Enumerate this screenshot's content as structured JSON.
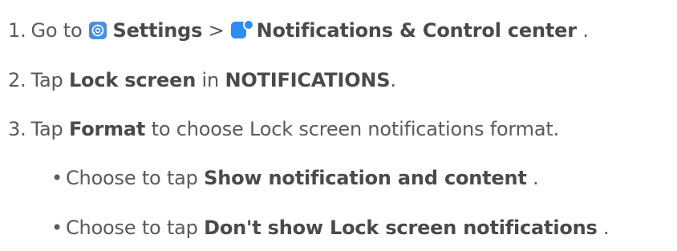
{
  "steps": [
    {
      "number": "1.",
      "t1": "Go to",
      "settings_label": "Settings",
      "separator": ">",
      "notifications_label": "Notifications & Control center",
      "end": "."
    },
    {
      "number": "2.",
      "t1": "Tap",
      "b1": "Lock screen",
      "t2": "in",
      "b2": "NOTIFICATIONS",
      "end": "."
    },
    {
      "number": "3.",
      "t1": "Tap",
      "b1": "Format",
      "t2": "to choose Lock screen notifications format."
    }
  ],
  "options": [
    {
      "bullet": "•",
      "t1": "Choose to tap",
      "b1": "Show notification and content",
      "end": "."
    },
    {
      "bullet": "•",
      "t1": "Choose to tap",
      "b1": "Don't show Lock screen notifications",
      "end": "."
    }
  ],
  "icons": {
    "settings": "settings-icon",
    "notifications": "notifications-icon"
  },
  "colors": {
    "text": "#5a5a5a",
    "settings_icon": "#4a8fd9",
    "notifications_icon": "#2d8df0"
  }
}
